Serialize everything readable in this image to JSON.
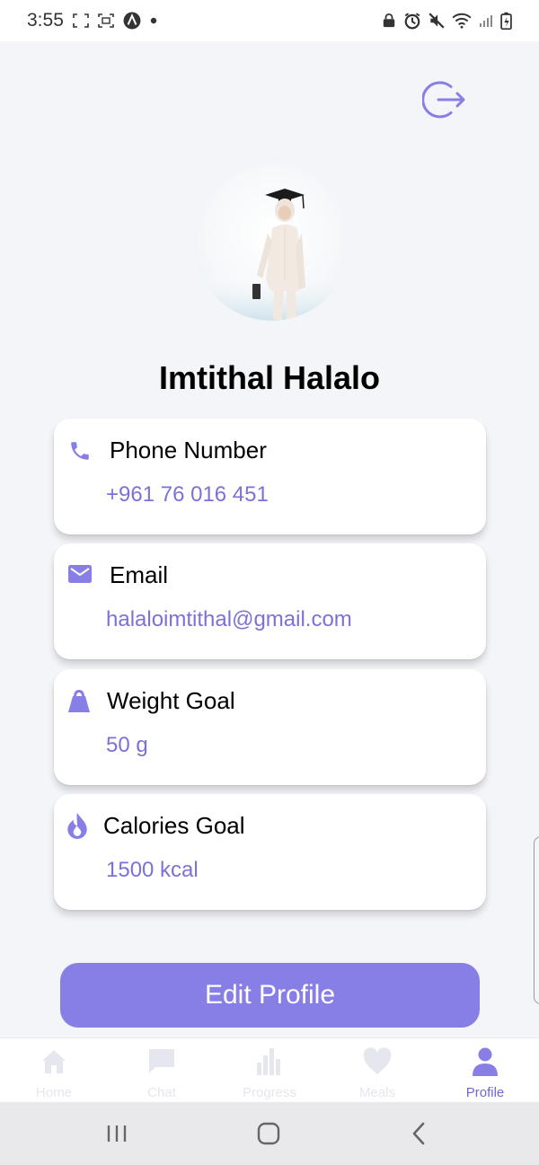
{
  "status_bar": {
    "time": "3:55"
  },
  "profile": {
    "name": "Imtithal Halalo"
  },
  "cards": [
    {
      "title": "Phone Number",
      "value": "+961 76 016 451",
      "icon": "phone-icon"
    },
    {
      "title": "Email",
      "value": "halaloimtithal@gmail.com",
      "icon": "email-icon"
    },
    {
      "title": "Weight Goal",
      "value": "50 g",
      "icon": "weight-icon"
    },
    {
      "title": "Calories Goal",
      "value": "1500 kcal",
      "icon": "flame-icon"
    }
  ],
  "edit_button": {
    "label": "Edit Profile"
  },
  "bottom_nav": {
    "items": [
      {
        "label": "Home",
        "icon": "home-icon",
        "active": false
      },
      {
        "label": "Chat",
        "icon": "chat-icon",
        "active": false
      },
      {
        "label": "Progress",
        "icon": "bar-chart-icon",
        "active": false
      },
      {
        "label": "Meals",
        "icon": "heart-icon",
        "active": false
      },
      {
        "label": "Profile",
        "icon": "person-icon",
        "active": true
      }
    ]
  },
  "colors": {
    "accent": "#877fe6",
    "accent_text": "#7a72d8",
    "background": "#f4f5f9",
    "inactive_nav": "#e6e6ee"
  }
}
